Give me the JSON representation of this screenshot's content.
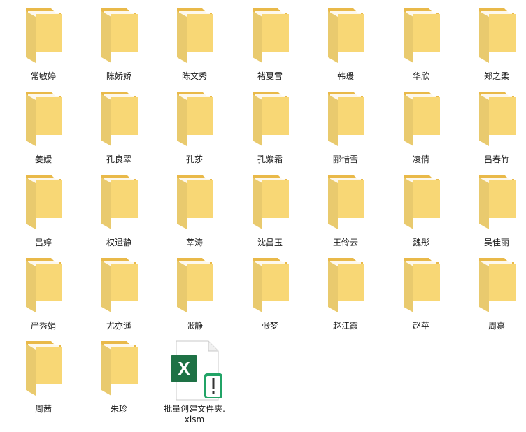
{
  "folders": [
    {
      "name": "常敏婷"
    },
    {
      "name": "陈娇娇"
    },
    {
      "name": "陈文秀"
    },
    {
      "name": "褚夏雪"
    },
    {
      "name": "韩瑗"
    },
    {
      "name": "华欣"
    },
    {
      "name": "郑之柔"
    },
    {
      "name": "姜嫒"
    },
    {
      "name": "孔良翠"
    },
    {
      "name": "孔莎"
    },
    {
      "name": "孔紫霜"
    },
    {
      "name": "郦惜雪"
    },
    {
      "name": "凌倩"
    },
    {
      "name": "吕春竹"
    },
    {
      "name": "吕婷"
    },
    {
      "name": "权逯静"
    },
    {
      "name": "莘涛"
    },
    {
      "name": "沈昌玉"
    },
    {
      "name": "王伶云"
    },
    {
      "name": "魏彤"
    },
    {
      "name": "吴佳丽"
    },
    {
      "name": "严秀娟"
    },
    {
      "name": "尤亦遥"
    },
    {
      "name": "张静"
    },
    {
      "name": "张梦"
    },
    {
      "name": "赵江霞"
    },
    {
      "name": "赵苹"
    },
    {
      "name": "周嘉"
    },
    {
      "name": "周茜"
    },
    {
      "name": "朱珍"
    }
  ],
  "file": {
    "name_line1": "批量创建文件夹.",
    "name_line2": "xlsm",
    "icon": "excel-macro-icon",
    "icon_letter": "X"
  },
  "colors": {
    "folder_back": "#e9b949",
    "folder_front": "#f8d775",
    "folder_paper": "#ffffff",
    "excel_green": "#1e7145",
    "excel_badge": "#21a366"
  }
}
